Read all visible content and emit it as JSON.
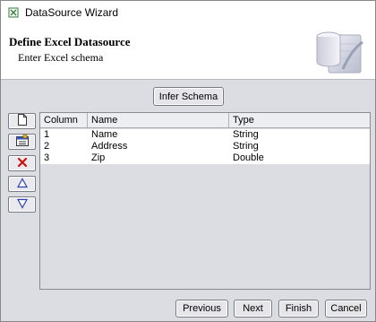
{
  "window": {
    "title": "DataSource Wizard"
  },
  "header": {
    "heading": "Define Excel Datasource",
    "subheading": "Enter Excel schema"
  },
  "toolbar": {
    "infer_schema": "Infer Schema"
  },
  "side_buttons": [
    "new-row-icon",
    "import-icon",
    "delete-icon",
    "move-up-icon",
    "move-down-icon"
  ],
  "table": {
    "columns": [
      "Column",
      "Name",
      "Type"
    ],
    "rows": [
      [
        "1",
        "Name",
        "String"
      ],
      [
        "2",
        "Address",
        "String"
      ],
      [
        "3",
        "Zip",
        "Double"
      ]
    ]
  },
  "footer": {
    "previous": "Previous",
    "next": "Next",
    "finish": "Finish",
    "cancel": "Cancel"
  },
  "colors": {
    "body_bg": "#dcdde3",
    "header_bg": "#ffffff",
    "delete_red": "#cc1111",
    "arrow_blue": "#2a3fb0"
  }
}
